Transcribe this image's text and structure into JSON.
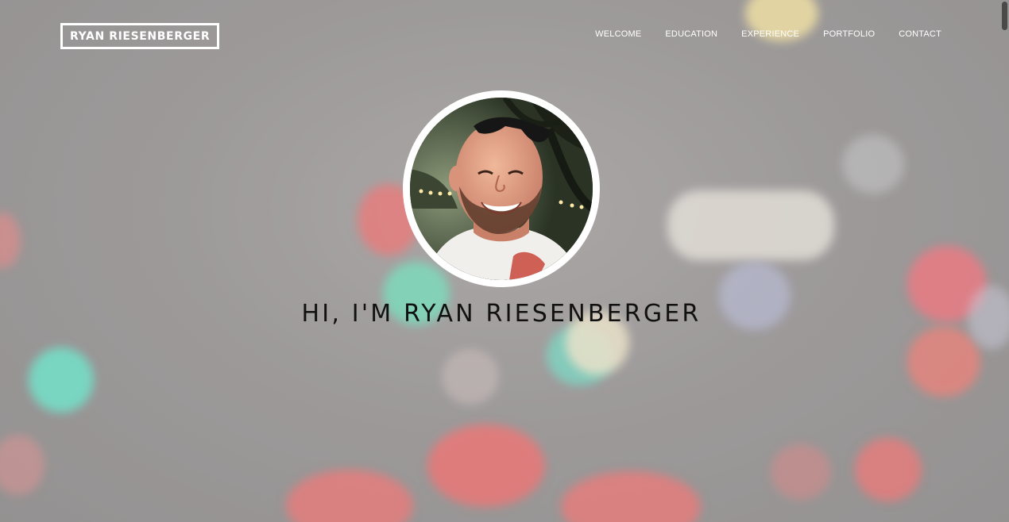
{
  "header": {
    "logo_text": "RYAN RIESENBERGER",
    "nav": [
      {
        "label": "WELCOME"
      },
      {
        "label": "EDUCATION"
      },
      {
        "label": "EXPERIENCE"
      },
      {
        "label": "PORTFOLIO"
      },
      {
        "label": "CONTACT"
      }
    ]
  },
  "hero": {
    "title": "HI, I'M RYAN RIESENBERGER",
    "avatar_icon": "profile-photo"
  },
  "colors": {
    "text_light": "#ffffff",
    "title_text": "#111111",
    "background": "#9e9b9b"
  }
}
